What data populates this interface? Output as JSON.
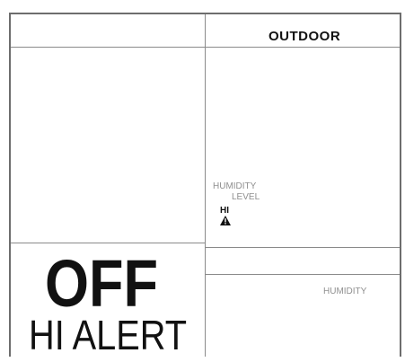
{
  "header": {
    "outdoor_label": "OUTDOOR"
  },
  "humidity_level": {
    "line1": "HUMIDITY",
    "line2": "LEVEL",
    "status": "HI"
  },
  "display": {
    "main_value": "OFF",
    "alert_text": "HI ALERT"
  },
  "lower_panel": {
    "humidity_label": "HUMIDITY"
  },
  "icons": {
    "warning": "warning-icon"
  },
  "colors": {
    "border": "#6d6d6d",
    "grid": "#8a8a8a",
    "text": "#111111",
    "muted": "#8f8f8f",
    "background": "#ffffff"
  }
}
